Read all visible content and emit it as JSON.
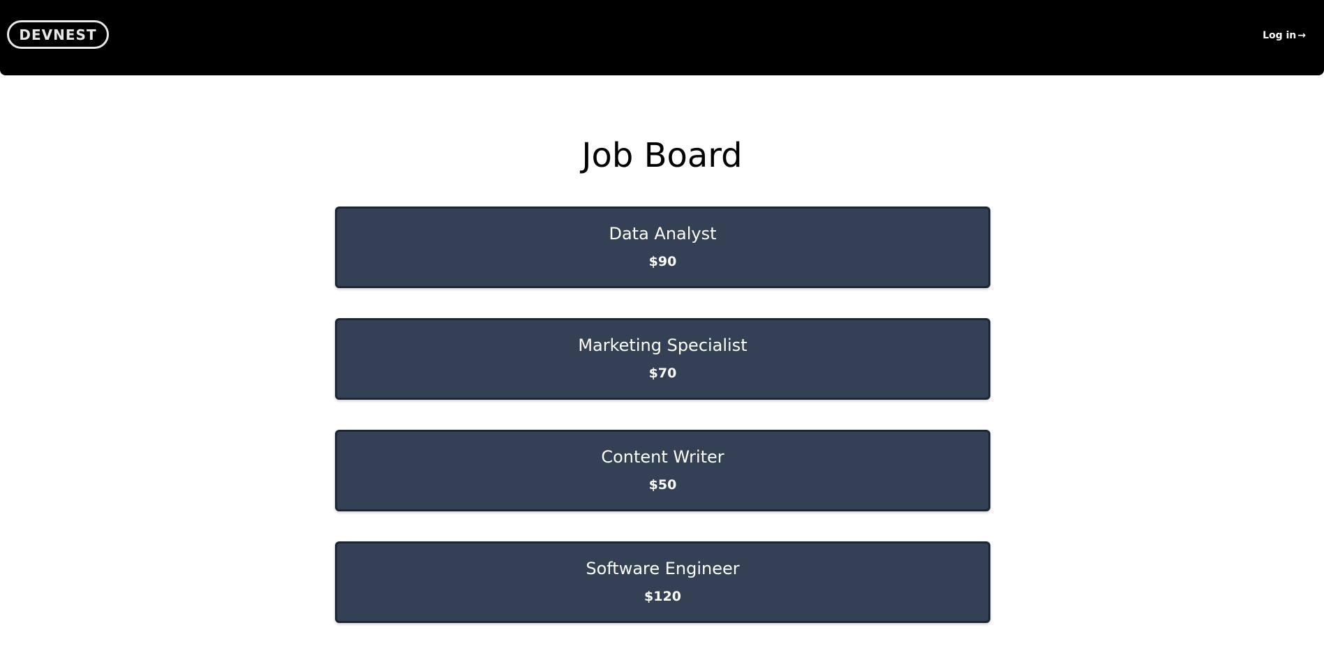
{
  "header": {
    "logo_text": "DEVNEST",
    "login_label": "Log in",
    "login_arrow": "→"
  },
  "page": {
    "title": "Job Board"
  },
  "jobs": [
    {
      "title": "Data Analyst",
      "rate": "$90"
    },
    {
      "title": "Marketing Specialist",
      "rate": "$70"
    },
    {
      "title": "Content Writer",
      "rate": "$50"
    },
    {
      "title": "Software Engineer",
      "rate": "$120"
    }
  ],
  "colors": {
    "header_bg": "#000000",
    "card_bg": "#344154",
    "card_border": "#1d2634",
    "card_text": "#ffffff"
  }
}
